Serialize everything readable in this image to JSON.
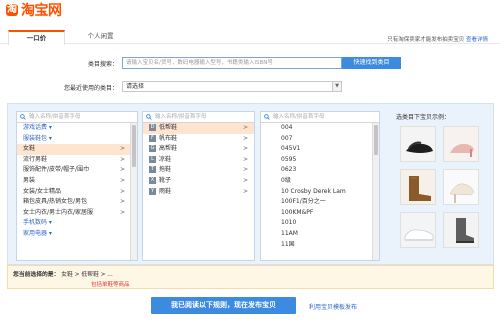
{
  "brand": {
    "logo_mark": "淘",
    "name": "淘宝网"
  },
  "tabs": [
    {
      "label": "一口价",
      "active": true
    },
    {
      "label": "个人闲置",
      "active": false
    }
  ],
  "top_note": {
    "text": "只有淘保卖家才能发布拍卖宝贝",
    "link": "查看详情"
  },
  "search": {
    "label": "类目搜索：",
    "placeholder": "请输入宝贝名/货号，数码电器输入型号，书籍类输入ISBN号",
    "button": "快速找到类目"
  },
  "recent": {
    "label": "您最近使用的类目：",
    "value": "请选择"
  },
  "columns": {
    "search_placeholder": "输入名称/拼音首字母",
    "col1": [
      {
        "label": "游戏话费",
        "type": "group"
      },
      {
        "label": "服装鞋包",
        "type": "group"
      },
      {
        "label": "女鞋",
        "type": "item",
        "selected": true
      },
      {
        "label": "流行男鞋",
        "type": "item"
      },
      {
        "label": "服饰配件/皮带/帽子/围巾",
        "type": "item"
      },
      {
        "label": "男装",
        "type": "item"
      },
      {
        "label": "女装/女士精品",
        "type": "item"
      },
      {
        "label": "箱包皮具/热销女包/男包",
        "type": "item"
      },
      {
        "label": "女士内衣/男士内衣/家居服",
        "type": "item"
      },
      {
        "label": "手机数码",
        "type": "group"
      },
      {
        "label": "家用电器",
        "type": "group"
      }
    ],
    "col2": [
      {
        "letter": "D",
        "label": "低帮鞋",
        "selected": true
      },
      {
        "letter": "F",
        "label": "帆布鞋"
      },
      {
        "letter": "G",
        "label": "高帮鞋"
      },
      {
        "letter": "L",
        "label": "凉鞋"
      },
      {
        "letter": "T",
        "label": "拖鞋"
      },
      {
        "letter": "X",
        "label": "靴子"
      },
      {
        "letter": "Y",
        "label": "雨鞋"
      }
    ],
    "col3": [
      "004",
      "007",
      "045V1",
      "0595",
      "0623",
      "0级",
      "10 Crosby Derek Lam",
      "100F1/百分之一",
      "100KM&PF",
      "1010",
      "11AM",
      "11国"
    ]
  },
  "examples": {
    "title": "选类目下宝贝示例："
  },
  "path": {
    "label": "您当前选择的是：",
    "value": "女鞋 > 低帮鞋 > ...",
    "forbid": "包括单鞋等商品"
  },
  "publish_button": "我已阅读以下规则，现在发布宝贝",
  "template_link": "利用宝贝模板发布",
  "colors": {
    "accent": "#ff5000",
    "primary_blue": "#3d8be0",
    "link": "#3366cc"
  }
}
